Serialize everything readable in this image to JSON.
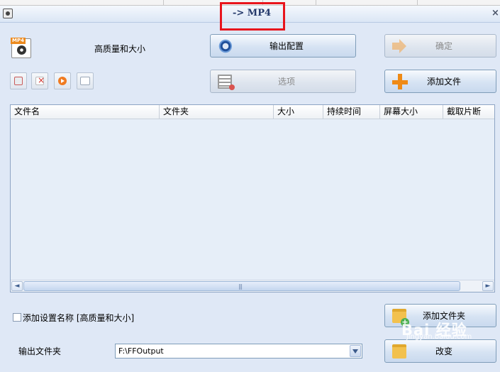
{
  "window": {
    "title": "-> MP4",
    "close_glyph": "×"
  },
  "format": {
    "tag": "MP4",
    "quality_label": "高质量和大小"
  },
  "buttons": {
    "output_config": "输出配置",
    "ok": "确定",
    "options": "选项",
    "add_file": "添加文件",
    "add_folder": "添加文件夹",
    "change": "改变"
  },
  "list": {
    "columns": [
      "文件名",
      "文件夹",
      "大小",
      "持续时间",
      "屏幕大小",
      "截取片断"
    ],
    "rows": []
  },
  "footer": {
    "checkbox_label": "添加设置名称 [高质量和大小]",
    "checkbox_checked": false,
    "output_folder_label": "输出文件夹",
    "output_folder_value": "F:\\FFOutput"
  },
  "scrollbar": {
    "left": "◄",
    "right": "►",
    "grip": "|||"
  },
  "watermark": {
    "text": "Bai 经验",
    "sub": "jingyan.baidu.com"
  },
  "colors": {
    "window_bg": "#dfe8f6",
    "highlight_box": "#e8141c",
    "accent_orange": "#ef8a16"
  }
}
